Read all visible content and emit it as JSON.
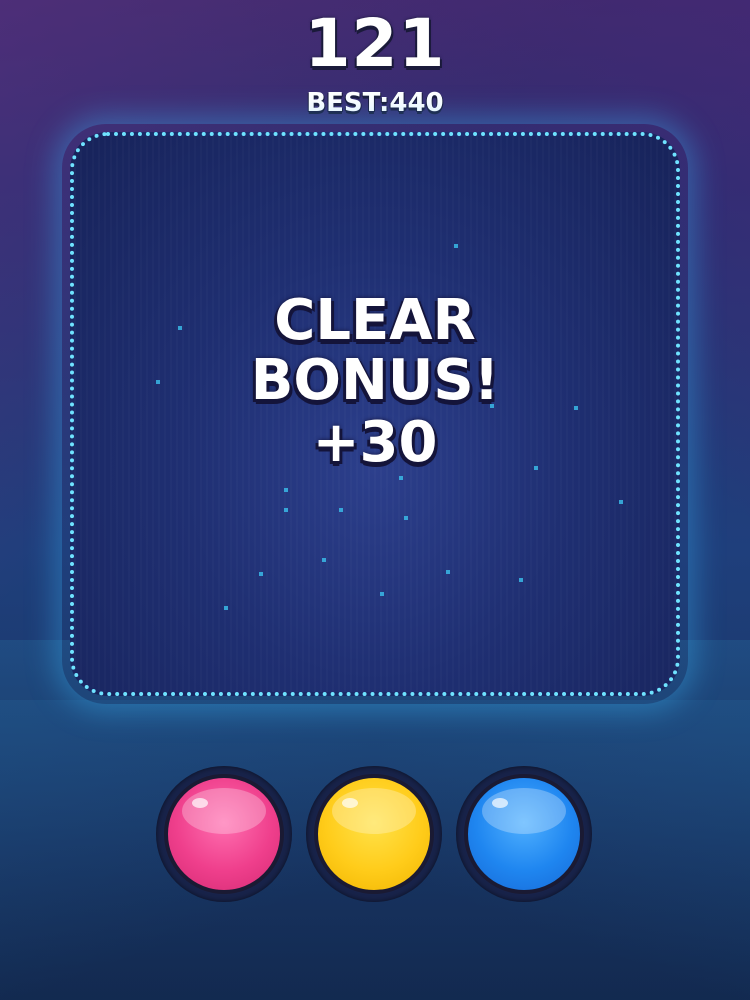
{
  "hud": {
    "score": "121",
    "best_label": "BEST:",
    "best_value": "440"
  },
  "board": {
    "bonus_line1": "CLEAR",
    "bonus_line2": "BONUS!",
    "bonus_line3": "+30"
  },
  "color_buttons": [
    {
      "color_name": "pink",
      "color": "#ef3f8c"
    },
    {
      "color_name": "yellow",
      "color": "#ffcc1a"
    },
    {
      "color_name": "blue",
      "color": "#1f86f0"
    }
  ],
  "colors": {
    "board_border": "#6fe3ff",
    "board_fill": "#1f2f72",
    "particle": "#3ab8e6"
  }
}
